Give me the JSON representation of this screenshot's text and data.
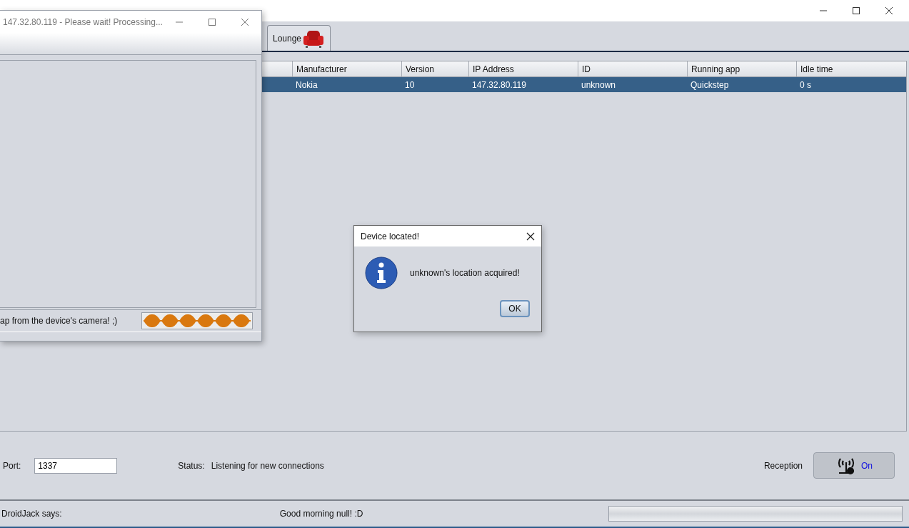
{
  "tabs": [
    {
      "label": "Lounge",
      "selected": false
    }
  ],
  "table": {
    "columns": [
      "Manufacturer",
      "Version",
      "IP Address",
      "ID",
      "Running app",
      "Idle time"
    ],
    "rows": [
      {
        "cells": [
          "Nokia",
          "10",
          "147.32.80.119",
          "unknown",
          "Quickstep",
          "0 s"
        ],
        "selected": true
      }
    ]
  },
  "port": {
    "label": "Port:",
    "value": "1337"
  },
  "status": {
    "label": "Status:",
    "text": "Listening for new connections"
  },
  "reception": {
    "label": "Reception",
    "button": "On",
    "on": true
  },
  "status_bar": {
    "label": "DroidJack says:",
    "message": "Good morning null! :D",
    "level": 0
  },
  "camera_window": {
    "title": "147.32.80.119 - Please wait! Processing...",
    "message": "ap from the device's camera! ;)"
  },
  "dialog": {
    "title": "Device located!",
    "message": "unknown's location acquired!",
    "button": "OK"
  }
}
